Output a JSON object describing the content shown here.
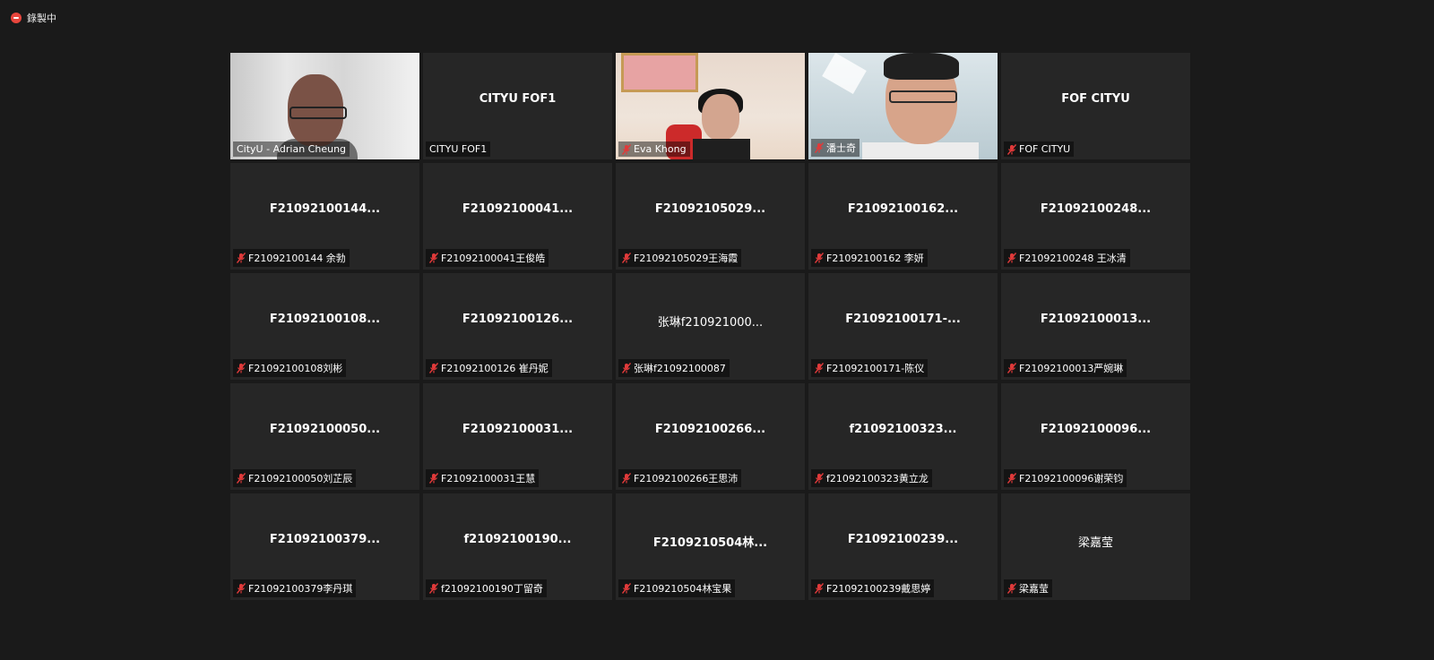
{
  "recording": {
    "label": "錄製中"
  },
  "tiles": [
    {
      "title": "",
      "name": "CityU - Adrian Cheung",
      "muted": false,
      "video": "v1",
      "active": true
    },
    {
      "title": "CITYU FOF1",
      "name": "CITYU FOF1",
      "muted": false
    },
    {
      "title": "",
      "name": "Eva Khong",
      "muted": true,
      "video": "v3"
    },
    {
      "title": "",
      "name": "潘士奇",
      "muted": true,
      "video": "v4"
    },
    {
      "title": "FOF CITYU",
      "name": "FOF CITYU",
      "muted": true
    },
    {
      "title": "F21092100144...",
      "name": "F21092100144 余勃",
      "muted": true
    },
    {
      "title": "F21092100041...",
      "name": "F21092100041王俊皓",
      "muted": true
    },
    {
      "title": "F21092105029...",
      "name": "F21092105029王海霞",
      "muted": true
    },
    {
      "title": "F21092100162...",
      "name": "F21092100162 李妍",
      "muted": true
    },
    {
      "title": "F21092100248...",
      "name": "F21092100248 王冰清",
      "muted": true
    },
    {
      "title": "F21092100108...",
      "name": "F21092100108刘彬",
      "muted": true
    },
    {
      "title": "F21092100126...",
      "name": "F21092100126 崔丹妮",
      "muted": true
    },
    {
      "title": "张琳f210921000...",
      "name": "张琳f21092100087",
      "muted": true,
      "light": true
    },
    {
      "title": "F21092100171-...",
      "name": "F21092100171-陈仪",
      "muted": true
    },
    {
      "title": "F21092100013...",
      "name": "F21092100013严婉琳",
      "muted": true
    },
    {
      "title": "F21092100050...",
      "name": "F21092100050刘芷辰",
      "muted": true
    },
    {
      "title": "F21092100031...",
      "name": "F21092100031王慧",
      "muted": true
    },
    {
      "title": "F21092100266...",
      "name": "F21092100266王思沛",
      "muted": true
    },
    {
      "title": "f21092100323...",
      "name": "f21092100323黄立龙",
      "muted": true
    },
    {
      "title": "F21092100096...",
      "name": "F21092100096谢荣钧",
      "muted": true
    },
    {
      "title": "F21092100379...",
      "name": "F21092100379李丹琪",
      "muted": true
    },
    {
      "title": "f21092100190...",
      "name": "f21092100190丁留奇",
      "muted": true
    },
    {
      "title": "F2109210504林...",
      "name": "F2109210504林宝果",
      "muted": true
    },
    {
      "title": "F21092100239...",
      "name": "F21092100239戴思婷",
      "muted": true
    },
    {
      "title": "梁嘉莹",
      "name": "梁嘉莹",
      "muted": true,
      "light": true
    }
  ]
}
